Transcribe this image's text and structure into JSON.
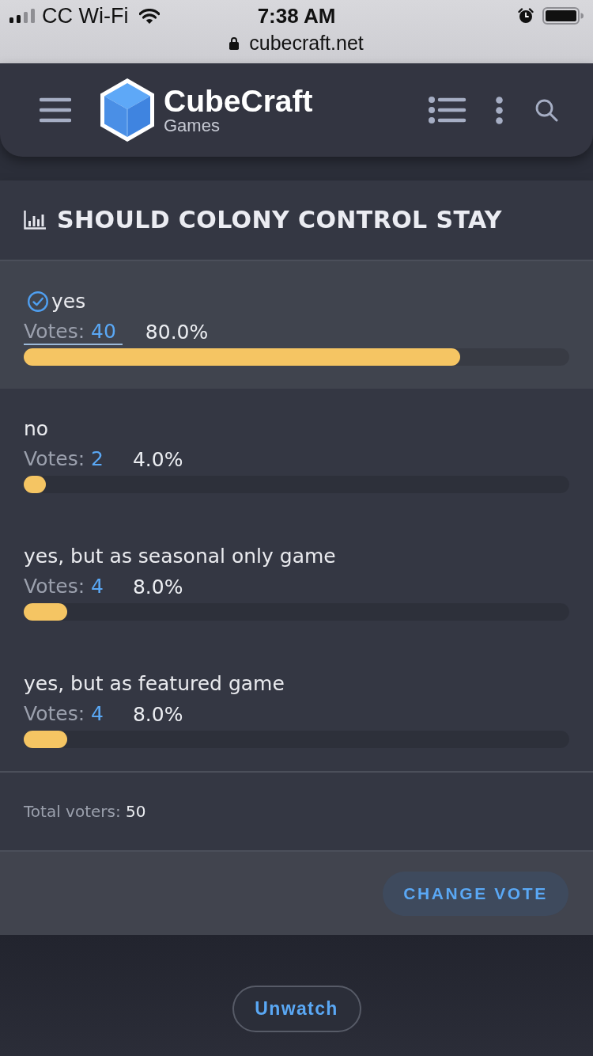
{
  "status_bar": {
    "carrier": "CC Wi-Fi",
    "time": "7:38 AM"
  },
  "address_bar": {
    "url": "cubecraft.net"
  },
  "header": {
    "logo_title": "CubeCraft",
    "logo_subtitle": "Games"
  },
  "poll": {
    "title": "SHOULD COLONY CONTROL STAY",
    "options": [
      {
        "label": "yes",
        "votes_label": "Votes:",
        "votes": "40",
        "percent": "80.0%",
        "level": 0.8,
        "selected": true,
        "underlined": true
      },
      {
        "label": "no",
        "votes_label": "Votes:",
        "votes": "2",
        "percent": "4.0%",
        "level": 0.04,
        "selected": false,
        "underlined": false
      },
      {
        "label": "yes, but as seasonal only game",
        "votes_label": "Votes:",
        "votes": "4",
        "percent": "8.0%",
        "level": 0.08,
        "selected": false,
        "underlined": false
      },
      {
        "label": "yes, but as featured game",
        "votes_label": "Votes:",
        "votes": "4",
        "percent": "8.0%",
        "level": 0.08,
        "selected": false,
        "underlined": false
      }
    ],
    "total_label": "Total voters:",
    "total": "50",
    "button": "CHANGE VOTE"
  },
  "unwatch_button": "Unwatch"
}
